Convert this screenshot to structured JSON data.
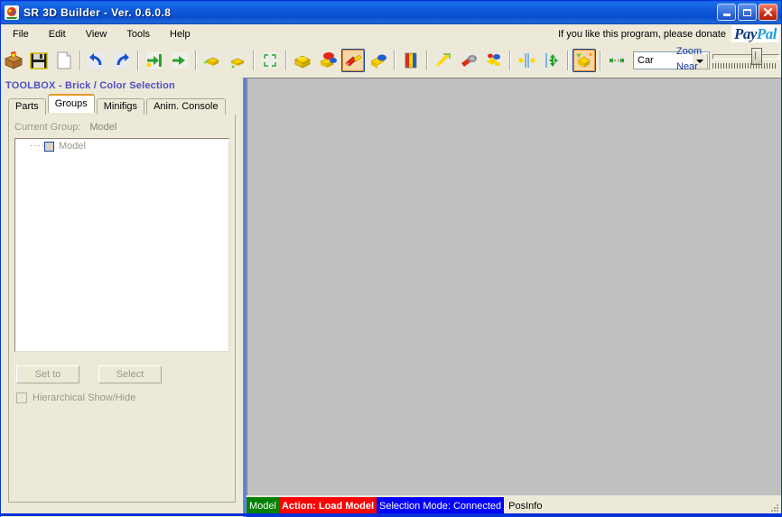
{
  "window": {
    "title": "SR 3D Builder  -  Ver. 0.6.0.8",
    "icon": "app-logo-icon",
    "minimize_label": "Minimize",
    "maximize_label": "Maximize",
    "close_label": "Close"
  },
  "menu": {
    "items": [
      {
        "label": "File"
      },
      {
        "label": "Edit"
      },
      {
        "label": "View"
      },
      {
        "label": "Tools"
      },
      {
        "label": "Help"
      }
    ],
    "donate_text": "If you like this program, please donate",
    "paypal": {
      "part1": "Pay",
      "part2": "Pal"
    }
  },
  "toolbar": {
    "buttons": [
      {
        "name": "open-model-button",
        "icon": "open-box-icon",
        "selected": false
      },
      {
        "name": "save-model-button",
        "icon": "floppy-disk-icon",
        "selected": false
      },
      {
        "name": "new-model-button",
        "icon": "blank-page-icon",
        "selected": false
      },
      {
        "name": "undo-button",
        "icon": "undo-arrow-icon",
        "selected": false
      },
      {
        "name": "redo-button",
        "icon": "redo-arrow-icon",
        "selected": false
      },
      {
        "name": "insert-before-button",
        "icon": "arrow-to-bar-left-icon",
        "selected": false
      },
      {
        "name": "insert-after-button",
        "icon": "arrow-to-bar-right-icon",
        "selected": false
      },
      {
        "name": "add-brick-button",
        "icon": "brick-add-icon",
        "selected": false
      },
      {
        "name": "remove-brick-button",
        "icon": "brick-remove-icon",
        "selected": false
      },
      {
        "name": "rotate-ccw-button",
        "icon": "rotate-arrows-icon",
        "selected": false
      },
      {
        "name": "brick-mode-button",
        "icon": "yellow-brick-icon",
        "selected": false
      },
      {
        "name": "color-brick-button",
        "icon": "red-brick-icon",
        "selected": false
      },
      {
        "name": "connect-brick-button",
        "icon": "red-axle-brick-icon",
        "selected": true
      },
      {
        "name": "blue-brick-button",
        "icon": "blue-yellow-brick-icon",
        "selected": false
      },
      {
        "name": "flag-color-button",
        "icon": "color-flag-icon",
        "selected": false
      },
      {
        "name": "technic-beam-button",
        "icon": "yellow-beam-icon",
        "selected": false
      },
      {
        "name": "motor-button",
        "icon": "motor-icon",
        "selected": false
      },
      {
        "name": "assembly-button",
        "icon": "assembly-icon",
        "selected": false
      },
      {
        "name": "mirror-button",
        "icon": "mirror-icon",
        "selected": false
      },
      {
        "name": "move-button",
        "icon": "move-cross-icon",
        "selected": false
      },
      {
        "name": "select-connected-button",
        "icon": "brick-pick-icon",
        "selected": true
      },
      {
        "name": "measure-button",
        "icon": "measure-icon",
        "selected": false
      }
    ],
    "model_combo": {
      "value": "Car",
      "placeholder": "Car",
      "arrow_icon": "chevron-down-icon"
    },
    "zoom": {
      "label": "Zoom",
      "near_label": "Near",
      "value": 60
    }
  },
  "left_panel": {
    "header": "TOOLBOX - Brick / Color Selection",
    "tabs": [
      {
        "label": "Parts",
        "active": false,
        "name": "tab-parts"
      },
      {
        "label": "Groups",
        "active": true,
        "name": "tab-groups"
      },
      {
        "label": "Minifigs",
        "active": false,
        "name": "tab-minifigs"
      },
      {
        "label": "Anim. Console",
        "active": false,
        "name": "tab-anim-console"
      }
    ],
    "current_group": {
      "label": "Current Group:",
      "value": "Model"
    },
    "tree": {
      "items": [
        {
          "label": "Model",
          "checked": false
        }
      ]
    },
    "set_to_label": "Set to",
    "select_label": "Select",
    "hierarchical_label": "Hierarchical  Show/Hide",
    "hierarchical_checked": false
  },
  "viewport": {
    "background_color": "#c0c0c0"
  },
  "statusbar": {
    "model": "Model",
    "action": "Action: Load Model",
    "selection_mode": "Selection Mode: Connected",
    "posinfo": "PosInfo",
    "colors": {
      "model_bg": "#008000",
      "action_bg": "#ff0000",
      "mode_bg": "#0000ff"
    }
  }
}
